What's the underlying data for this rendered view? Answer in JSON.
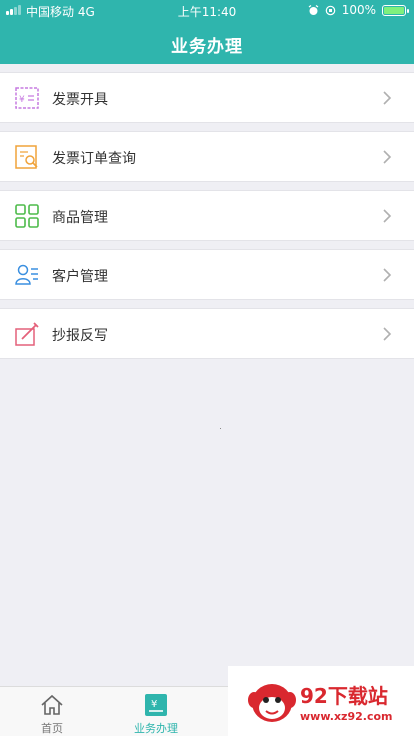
{
  "status_bar": {
    "carrier": "中国移动 4G",
    "time": "上午11:40",
    "battery": "100%"
  },
  "nav": {
    "title": "业务办理"
  },
  "menu": {
    "items": [
      {
        "label": "发票开具",
        "icon": "invoice-issue-icon",
        "color": "#c67ae0"
      },
      {
        "label": "发票订单查询",
        "icon": "invoice-search-icon",
        "color": "#f0a33a"
      },
      {
        "label": "商品管理",
        "icon": "goods-grid-icon",
        "color": "#4dbb4a"
      },
      {
        "label": "客户管理",
        "icon": "customer-icon",
        "color": "#3a8fe0"
      },
      {
        "label": "抄报反写",
        "icon": "report-edit-icon",
        "color": "#e4607a"
      }
    ]
  },
  "tabbar": {
    "tabs": [
      {
        "label": "首页",
        "icon": "home-icon",
        "active": false
      },
      {
        "label": "业务办理",
        "icon": "business-icon",
        "active": true
      }
    ],
    "accent": "#2fb5ad"
  },
  "watermark": {
    "brand": "92下载站",
    "url": "www.xz92.com"
  }
}
